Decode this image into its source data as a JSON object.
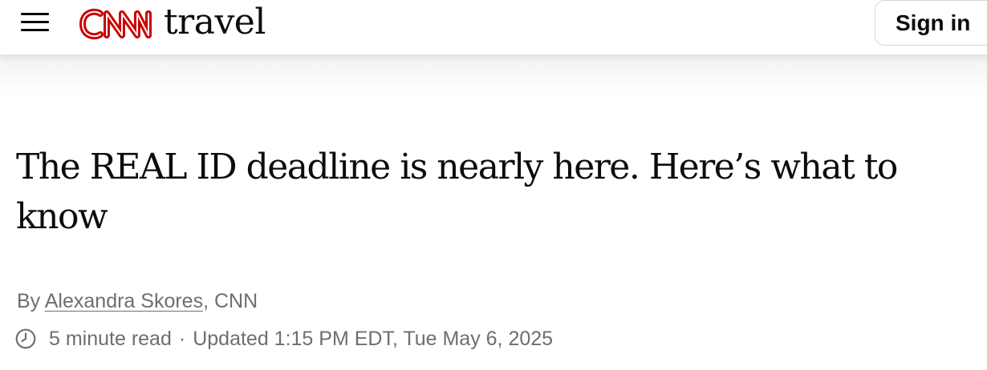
{
  "header": {
    "logo_text": "CNN",
    "section_name": "travel",
    "sign_in_label": "Sign in",
    "menu_icon": "hamburger-menu-icon"
  },
  "article": {
    "headline": "The REAL ID deadline is nearly here. Here’s what to know",
    "byline": {
      "prefix": "By ",
      "author": "Alexandra Skores",
      "suffix": ", CNN"
    },
    "read_icon": "clock-icon",
    "read_time": "5 minute read",
    "separator": "·",
    "updated": "Updated 1:15 PM EDT, Tue May 6, 2025"
  },
  "colors": {
    "brand_red": "#cc0000",
    "text_dark": "#0c0c0c",
    "text_muted": "#6e6e6e"
  }
}
